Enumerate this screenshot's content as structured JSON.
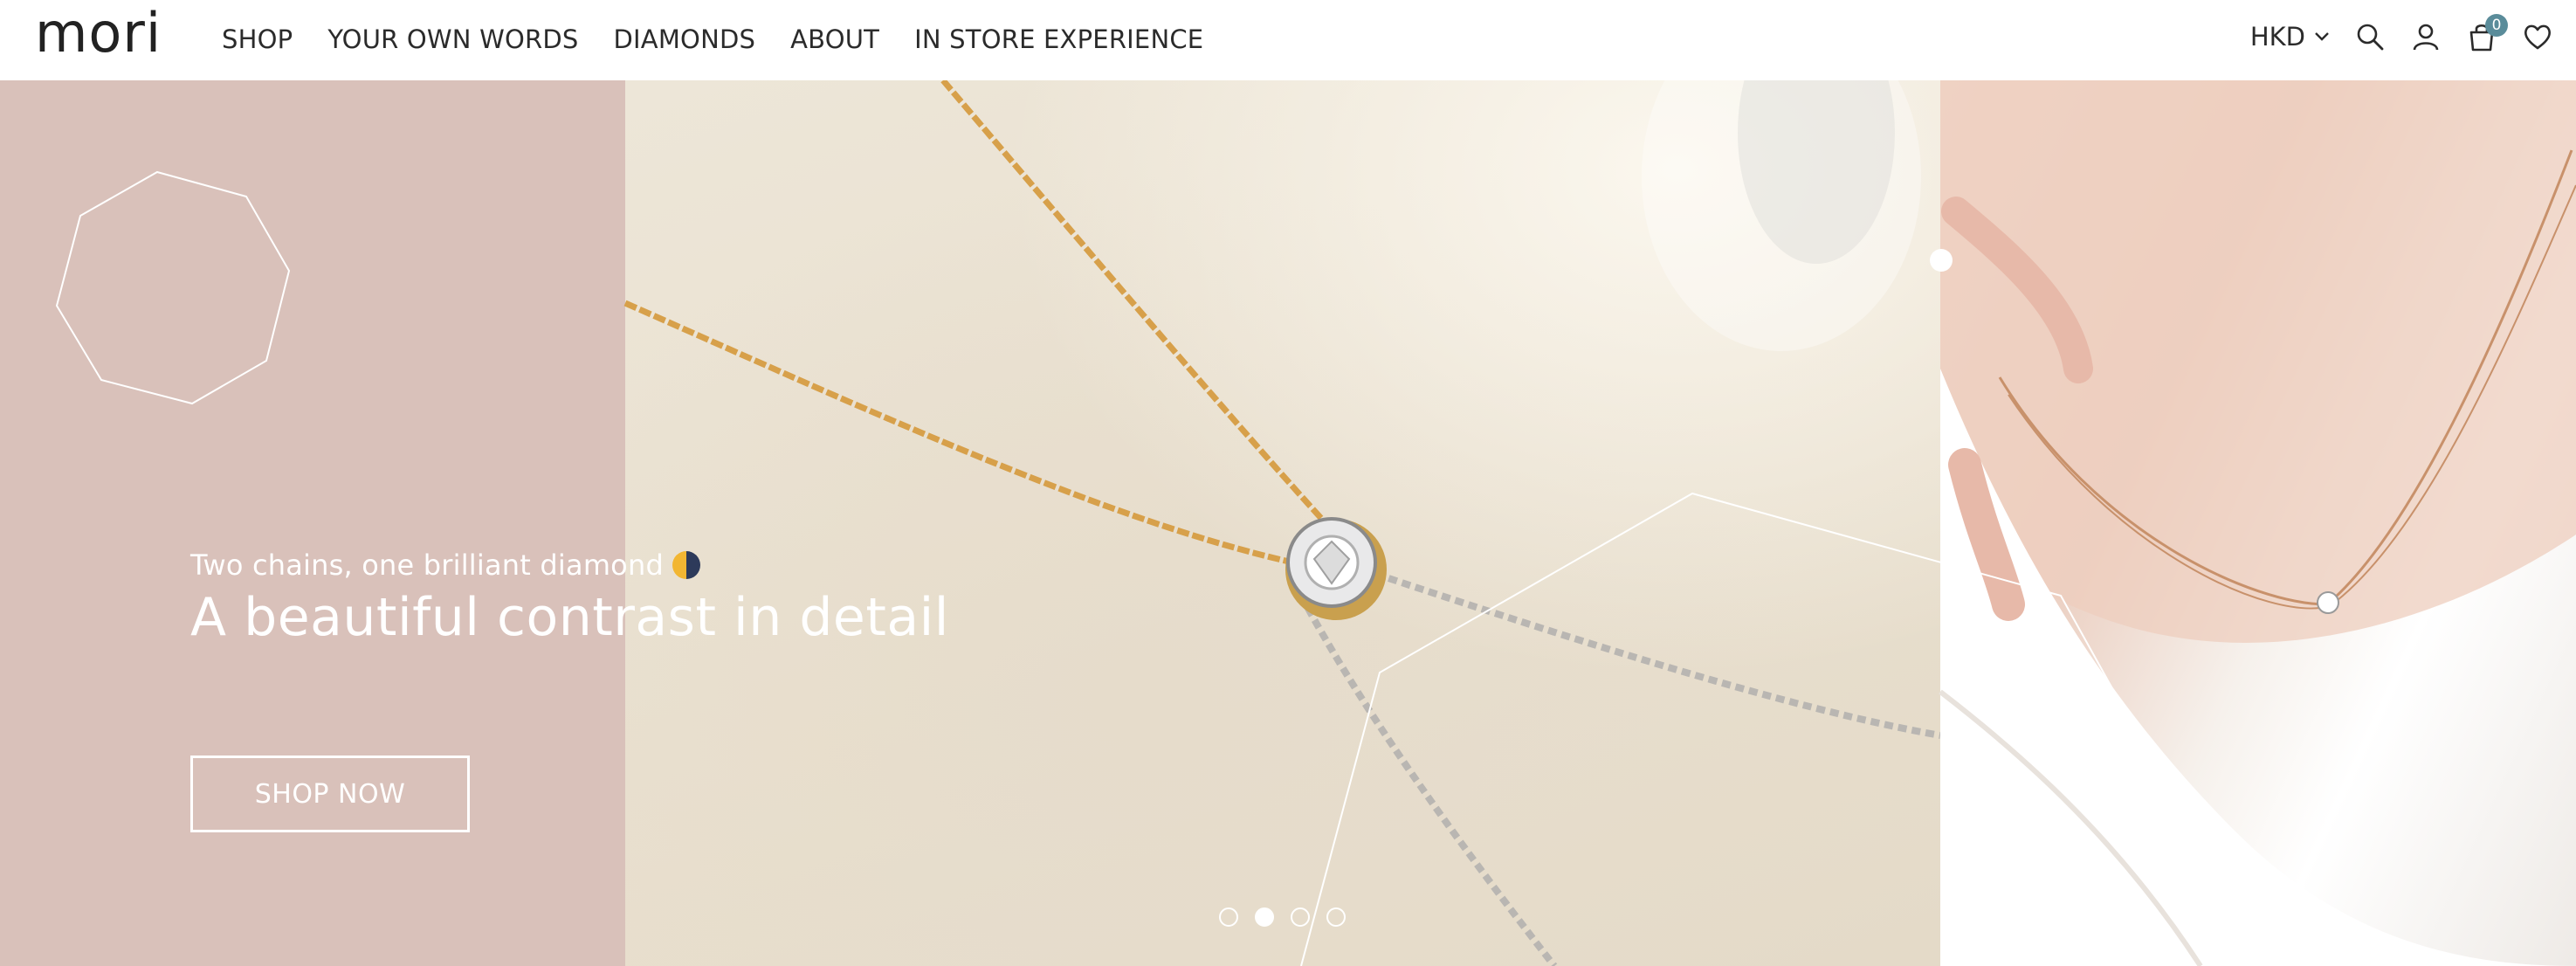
{
  "brand": {
    "logo_text": "mori"
  },
  "nav": {
    "items": [
      {
        "label": "SHOP"
      },
      {
        "label": "YOUR OWN WORDS"
      },
      {
        "label": "DIAMONDS"
      },
      {
        "label": "ABOUT"
      },
      {
        "label": "IN STORE EXPERIENCE"
      }
    ]
  },
  "tools": {
    "currency": "HKD",
    "cart_count": "0",
    "icons": [
      "search-icon",
      "account-icon",
      "cart-icon",
      "wishlist-icon"
    ]
  },
  "hero": {
    "subtitle": "Two chains, one brilliant diamond",
    "title": "A beautiful contrast in detail",
    "cta_label": "SHOP NOW",
    "slides_total": 4,
    "active_slide": 2,
    "left_panel_color": "#d9c1ba"
  }
}
